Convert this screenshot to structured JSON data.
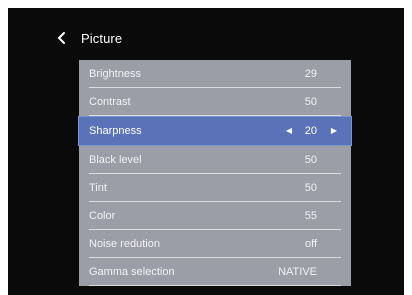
{
  "header": {
    "title": "Picture",
    "back_icon": "chevron-left-icon"
  },
  "menu": {
    "selected_color": "#5a72b8",
    "panel_color": "#9c9ea7",
    "items": [
      {
        "label": "Brightness",
        "value": "29"
      },
      {
        "label": "Contrast",
        "value": "50"
      },
      {
        "label": "Sharpness",
        "value": "20",
        "selected": true,
        "left_arrow": "◀",
        "right_arrow": "▶"
      },
      {
        "label": "Black level",
        "value": "50"
      },
      {
        "label": "Tint",
        "value": "50"
      },
      {
        "label": "Color",
        "value": "55"
      },
      {
        "label": "Noise redution",
        "value": "off"
      },
      {
        "label": "Gamma selection",
        "value": "NATIVE"
      }
    ]
  }
}
